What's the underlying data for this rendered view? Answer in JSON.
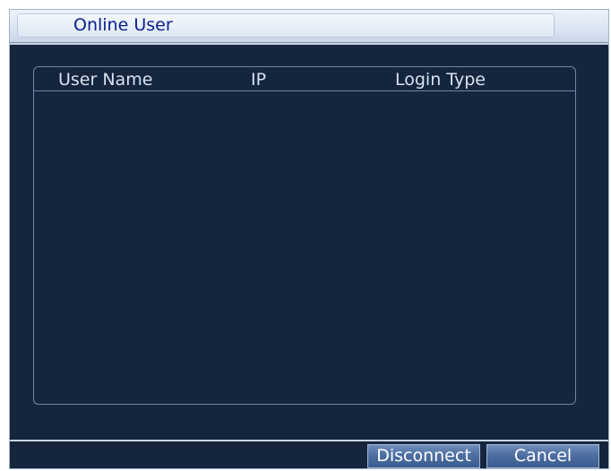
{
  "window": {
    "title": "Online User"
  },
  "table": {
    "columns": [
      "User Name",
      "IP",
      "Login Type"
    ],
    "rows": []
  },
  "buttons": {
    "disconnect": "Disconnect",
    "cancel": "Cancel"
  },
  "colors": {
    "background": "#14253d",
    "title_text": "#0a1f8c",
    "header_text": "#d7e2f1",
    "button_top": "#6f8dbb",
    "button_bottom": "#3b5b8e"
  }
}
